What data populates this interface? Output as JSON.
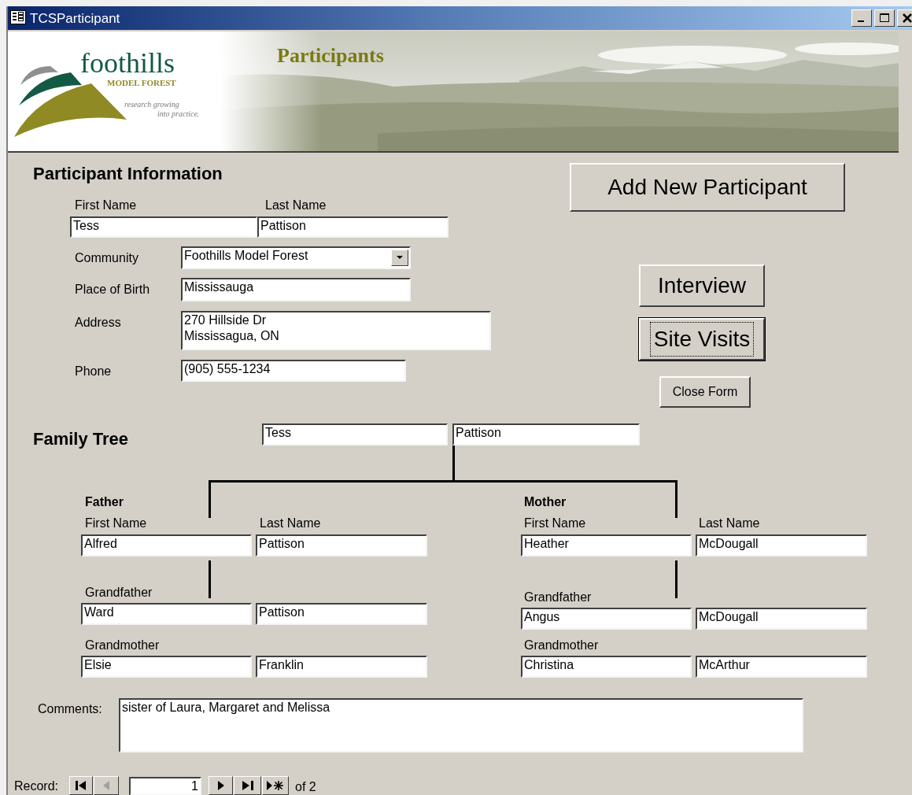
{
  "window": {
    "title": "TCSParticipant"
  },
  "header": {
    "logo_name": "foothills",
    "logo_subtitle": "MODEL FOREST",
    "tagline": [
      "research growing",
      "into practice."
    ],
    "title": "Participants"
  },
  "participant_information": {
    "heading": "Participant Information",
    "name_labels": [
      "First Name",
      "Last Name"
    ],
    "first_name": "Tess",
    "last_name": "Pattison",
    "fields": [
      {
        "label": "Community",
        "value": "Foothills Model Forest",
        "kind": "combo"
      },
      {
        "label": "Place of Birth",
        "value": "Mississauga",
        "kind": "text"
      },
      {
        "label": "Address",
        "value": "270 Hillside Dr\nMississagua, ON",
        "kind": "multiline"
      },
      {
        "label": "Phone",
        "value": "(905) 555-1234",
        "kind": "text"
      }
    ]
  },
  "buttons": [
    {
      "label": "Add New Participant",
      "focused": false
    },
    {
      "label": "Interview",
      "focused": false
    },
    {
      "label": "Site Visits",
      "focused": true
    },
    {
      "label": "Close Form",
      "focused": false
    }
  ],
  "family_tree": {
    "heading": "Family Tree",
    "first_name": "Tess",
    "last_name": "Pattison",
    "sides": [
      {
        "heading": "Father",
        "name_labels": [
          "First Name",
          "Last Name"
        ],
        "first_name": "Alfred",
        "last_name": "Pattison",
        "grandparents": [
          {
            "label": "Grandfather",
            "first_name": "Ward",
            "last_name": "Pattison"
          },
          {
            "label": "Grandmother",
            "first_name": "Elsie",
            "last_name": "Franklin"
          }
        ]
      },
      {
        "heading": "Mother",
        "name_labels": [
          "First Name",
          "Last Name"
        ],
        "first_name": "Heather",
        "last_name": "McDougall",
        "grandparents": [
          {
            "label": "Grandfather",
            "first_name": "Angus",
            "last_name": "McDougall"
          },
          {
            "label": "Grandmother",
            "first_name": "Christina",
            "last_name": "McArthur"
          }
        ]
      }
    ]
  },
  "comments": {
    "label": "Comments:",
    "value": "sister of Laura, Margaret and Melissa"
  },
  "record_navigator": {
    "label": "Record:",
    "current": "1",
    "total": "of 2",
    "buttons": [
      {
        "kind": "first",
        "disabled": false
      },
      {
        "kind": "previous",
        "disabled": true
      },
      {
        "kind": "next",
        "disabled": false
      },
      {
        "kind": "last",
        "disabled": false
      },
      {
        "kind": "new",
        "disabled": false
      }
    ]
  }
}
